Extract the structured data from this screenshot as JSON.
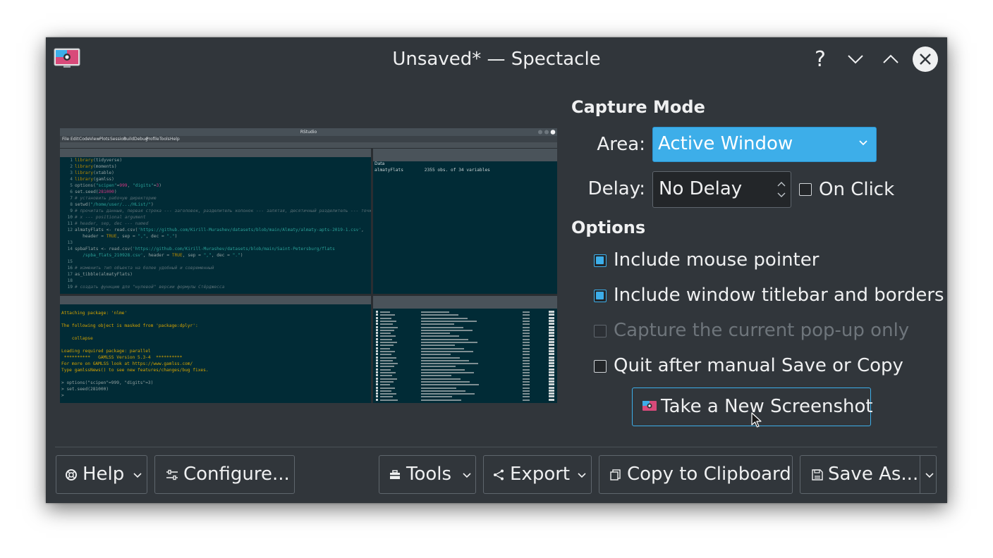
{
  "window": {
    "title": "Unsaved* — Spectacle"
  },
  "titlebar": {
    "help_glyph": "?"
  },
  "preview": {
    "window_title": "RStudio",
    "menu": [
      "File",
      "Edit",
      "Code",
      "View",
      "Plots",
      "Session",
      "Build",
      "Debug",
      "Profile",
      "Tools",
      "Help"
    ],
    "env_header": "Data",
    "env_row": "almatyFlats        2355 obs. of 34 variables"
  },
  "capture_mode": {
    "heading": "Capture Mode",
    "area_label": "Area:",
    "area_value": "Active Window",
    "delay_label": "Delay:",
    "delay_value": "No Delay",
    "on_click_label": "On Click",
    "on_click_checked": false
  },
  "options": {
    "heading": "Options",
    "items": [
      {
        "label": "Include mouse pointer",
        "checked": true,
        "enabled": true
      },
      {
        "label": "Include window titlebar and borders",
        "checked": true,
        "enabled": true
      },
      {
        "label": "Capture the current pop-up only",
        "checked": false,
        "enabled": false
      },
      {
        "label": "Quit after manual Save or Copy",
        "checked": false,
        "enabled": true
      }
    ]
  },
  "take_button_label": "Take a New Screenshot",
  "footer": {
    "help": "Help",
    "configure": "Configure...",
    "tools": "Tools",
    "export": "Export",
    "copy": "Copy to Clipboard",
    "save_as": "Save As..."
  },
  "colors": {
    "accent": "#3daee9",
    "window_bg": "#31363b",
    "editor_bg": "#012b36"
  }
}
